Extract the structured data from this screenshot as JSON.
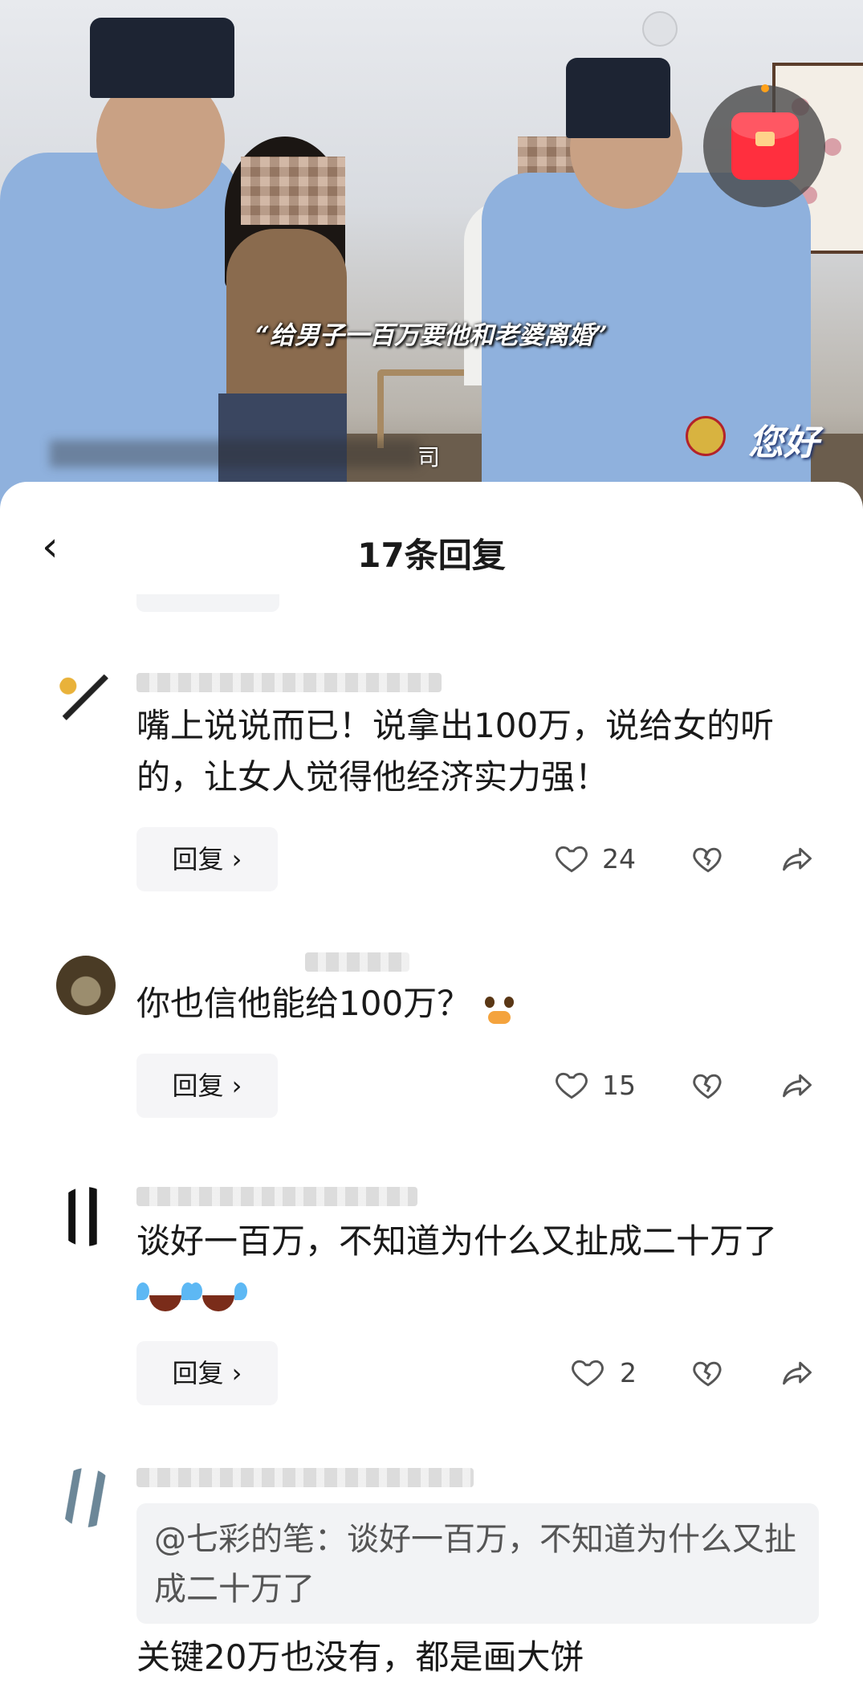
{
  "video": {
    "caption": "“给男子一百万要他和老婆离婚”",
    "subtitle_tail": "司",
    "watermark": "您好"
  },
  "header": {
    "back_icon": "chevron-left-icon",
    "title": "17条回复"
  },
  "comments": [
    {
      "avatar": "avatar",
      "text": "嘴上说说而已！说拿出100万，说给女的听的，让女人觉得他经济实力强！",
      "reply_label": "回复 ›",
      "likes": "24"
    },
    {
      "avatar": "avatar",
      "text": "你也信他能给100万？",
      "emoji": [
        "pleading-face-emoji"
      ],
      "reply_label": "回复 ›",
      "likes": "15"
    },
    {
      "avatar": "avatar",
      "text": "谈好一百万，不知道为什么又扯成二十万了",
      "emoji": [
        "laughing-crying-emoji",
        "laughing-crying-emoji"
      ],
      "reply_label": "回复 ›",
      "likes": "2"
    },
    {
      "avatar": "avatar",
      "quote": "@七彩的笔：谈好一百万，不知道为什么又扯成二十万了",
      "text": "关键20万也没有，都是画大饼"
    }
  ],
  "colors": {
    "sheet_bg": "#ffffff",
    "reply_btn_bg": "#f5f5f7",
    "quote_bg": "#f2f3f5",
    "red_packet": "#ff2f3e",
    "notification_dot": "#ffa11a"
  }
}
